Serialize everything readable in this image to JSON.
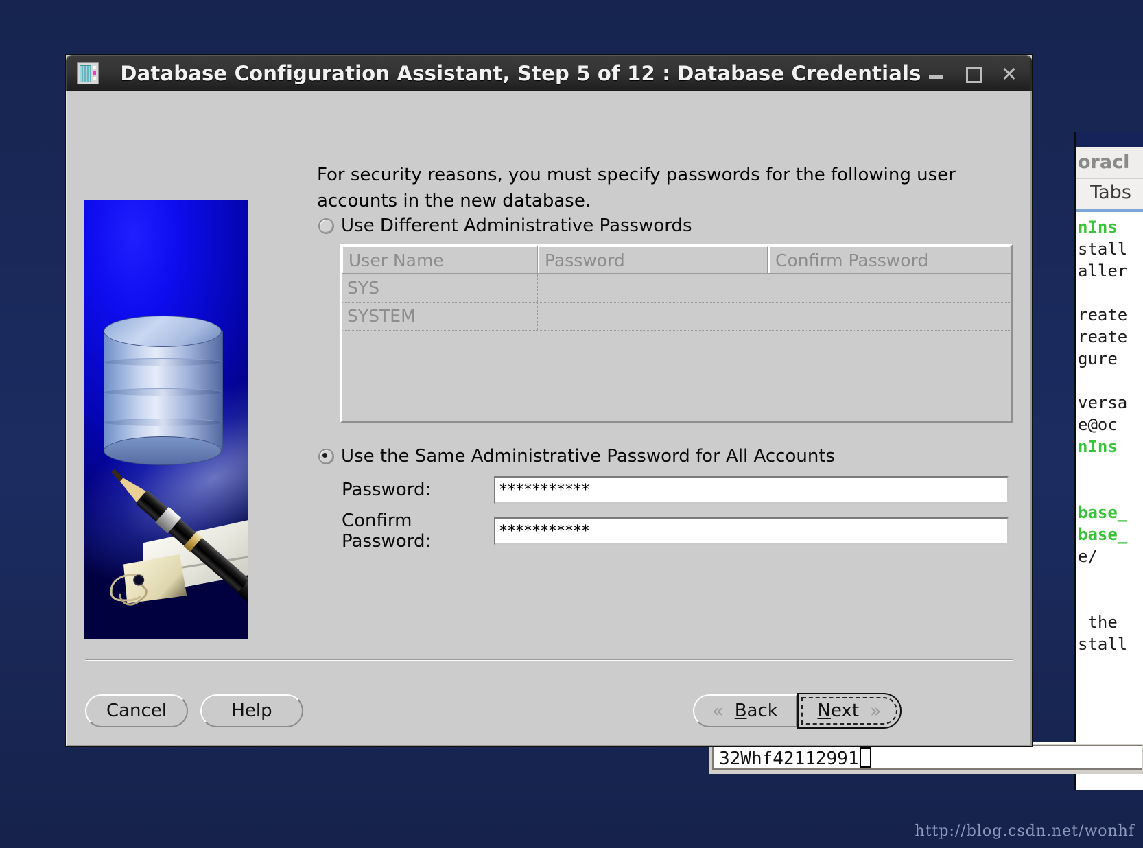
{
  "window": {
    "title": "Database Configuration Assistant, Step 5 of 12 : Database Credentials",
    "icon": "database-assistant-icon",
    "controls": {
      "minimize": "–",
      "maximize": "□",
      "close": "✕"
    }
  },
  "content": {
    "intro": "For security reasons, you must specify passwords for the following user accounts in the new database.",
    "option_different": {
      "label": "Use Different Administrative Passwords",
      "selected": false
    },
    "option_same": {
      "label": "Use the Same Administrative Password for All Accounts",
      "selected": true
    },
    "table": {
      "columns": [
        "User Name",
        "Password",
        "Confirm Password"
      ],
      "rows": [
        [
          "SYS",
          "",
          ""
        ],
        [
          "SYSTEM",
          "",
          ""
        ]
      ]
    },
    "password_field": {
      "label": "Password:",
      "value": "***********"
    },
    "confirm_field": {
      "label": "Confirm Password:",
      "value": "***********"
    }
  },
  "buttons": {
    "cancel": "Cancel",
    "help": "Help",
    "back": "Back",
    "back_mnemonic": "B",
    "back_rest": "ack",
    "next": "Next",
    "next_mnemonic": "N",
    "next_rest": "ext",
    "back_chevron": "«",
    "next_chevron": "»"
  },
  "background": {
    "terminal": {
      "menubar": "oracl",
      "tabs_label": "Tabs",
      "lines": [
        {
          "text": "nIns",
          "color": "green"
        },
        {
          "text": "stall",
          "color": "black"
        },
        {
          "text": "aller",
          "color": "black"
        },
        {
          "text": "",
          "color": "black"
        },
        {
          "text": "reate",
          "color": "black"
        },
        {
          "text": "reate",
          "color": "black"
        },
        {
          "text": "gure",
          "color": "black"
        },
        {
          "text": "",
          "color": "black"
        },
        {
          "text": "versa",
          "color": "black"
        },
        {
          "text": "e@oc",
          "color": "black"
        },
        {
          "text": "nIns",
          "color": "green"
        },
        {
          "text": "",
          "color": "black"
        },
        {
          "text": "",
          "color": "black"
        },
        {
          "text": "base_",
          "color": "green"
        },
        {
          "text": "base_",
          "color": "green"
        },
        {
          "text": "e/",
          "color": "black"
        },
        {
          "text": "",
          "color": "black"
        },
        {
          "text": "",
          "color": "black"
        },
        {
          "text": " the",
          "color": "black"
        },
        {
          "text": "stall",
          "color": "black"
        }
      ]
    },
    "text_input_value": "32Whf42112991"
  },
  "watermark": "http://blog.csdn.net/wonhf",
  "colors": {
    "dialog_face": "#cccccc",
    "titlebar": "#2d2d2d",
    "desktop": "#1b2a5e",
    "terminal_green": "#39c339"
  }
}
